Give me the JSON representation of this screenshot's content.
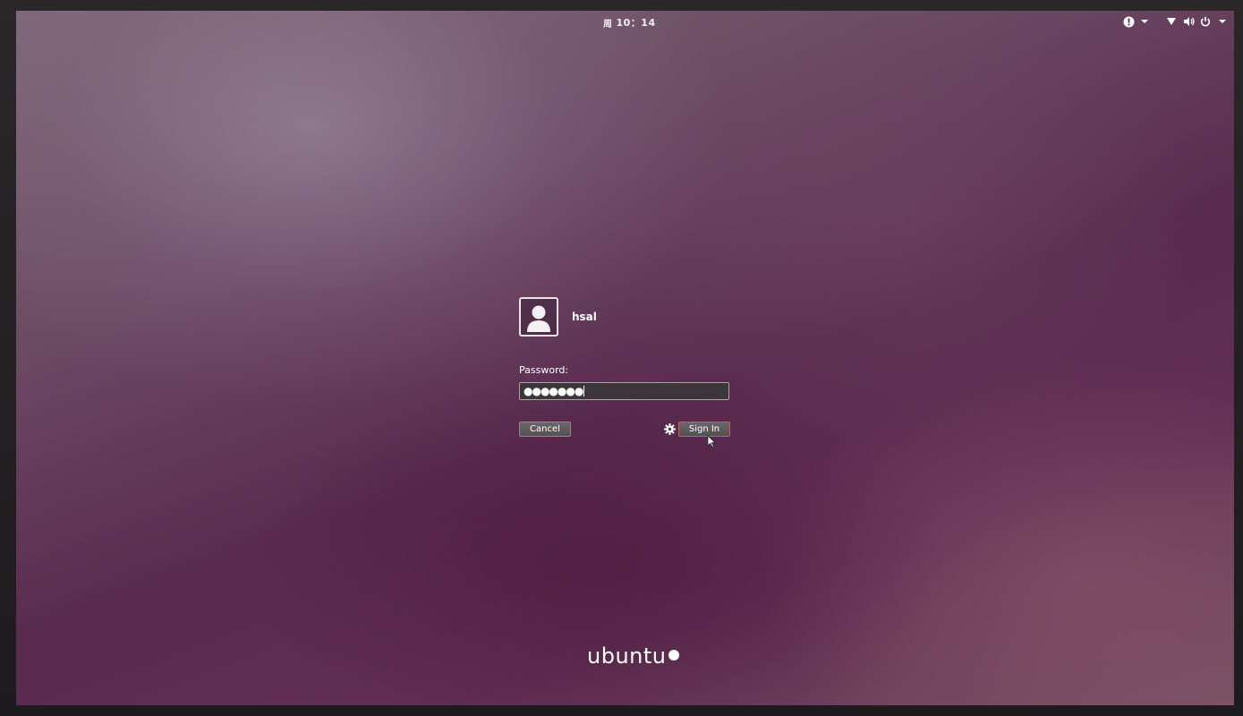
{
  "top_bar": {
    "clock_day": "周",
    "clock_time": "10：14"
  },
  "indicators": {
    "left": [
      "alert-icon",
      "chevron-down-icon"
    ],
    "right": [
      "network-icon",
      "volume-icon",
      "power-icon",
      "chevron-down-icon"
    ]
  },
  "login": {
    "username": "hsal",
    "password_label": "Password:",
    "password_value": "●●●●●●●",
    "cancel_label": "Cancel",
    "signin_label": "Sign In"
  },
  "branding": {
    "logo_text": "ubuntu"
  },
  "colors": {
    "accent_border": "#e25549",
    "background": "#5a2b4f"
  }
}
